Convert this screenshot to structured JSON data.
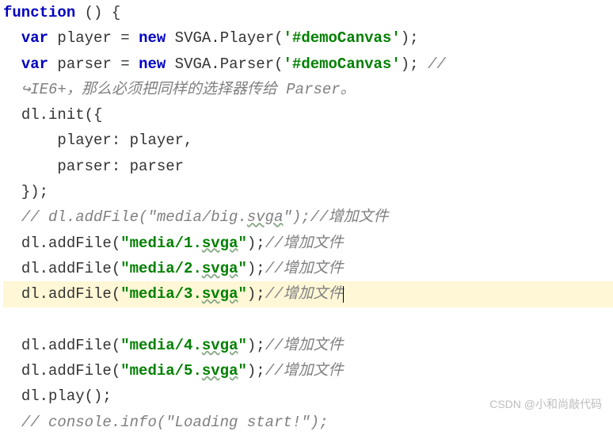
{
  "code": {
    "line1": {
      "a": "function",
      "b": " () {"
    },
    "line2": {
      "a": "var",
      "b": " player = ",
      "c": "new",
      "d": " SVGA.Player(",
      "e": "'#demoCanvas'",
      "f": ");"
    },
    "line3": {
      "a": "var",
      "b": " parser = ",
      "c": "new",
      "d": " SVGA.Parser(",
      "e": "'#demoCanvas'",
      "f": "); ",
      "g": "//"
    },
    "line4": {
      "a": "↪IE6+，那么必须把同样的选择器传给 Parser。"
    },
    "line5": {
      "a": "dl.init({"
    },
    "line6": {
      "a": "player: player,"
    },
    "line7": {
      "a": "parser: parser"
    },
    "line8": {
      "a": "});"
    },
    "line9": {
      "a": "// dl.addFile(\"media/big.",
      "b": "svga",
      "c": "\");//增加文件"
    },
    "line10": {
      "a": "dl.addFile(",
      "b": "\"media/1.",
      "c": "svga",
      "d": "\"",
      "e": ");",
      "f": "//增加文件"
    },
    "line11": {
      "a": "dl.addFile(",
      "b": "\"media/2.",
      "c": "svga",
      "d": "\"",
      "e": ");",
      "f": "//增加文件"
    },
    "line12": {
      "a": "dl.addFile(",
      "b": "\"media/3.",
      "c": "svga",
      "d": "\"",
      "e": ");",
      "f": "//增加文件"
    },
    "line13": {
      "a": "dl.addFile(",
      "b": "\"media/4.",
      "c": "svga",
      "d": "\"",
      "e": ");",
      "f": "//增加文件"
    },
    "line14": {
      "a": "dl.addFile(",
      "b": "\"media/5.",
      "c": "svga",
      "d": "\"",
      "e": ");",
      "f": "//增加文件"
    },
    "line15": {
      "a": "dl.play();"
    },
    "line16": {
      "a": "// console.info(\"Loading start!\");"
    }
  },
  "watermark": "CSDN @小和尚敲代码"
}
